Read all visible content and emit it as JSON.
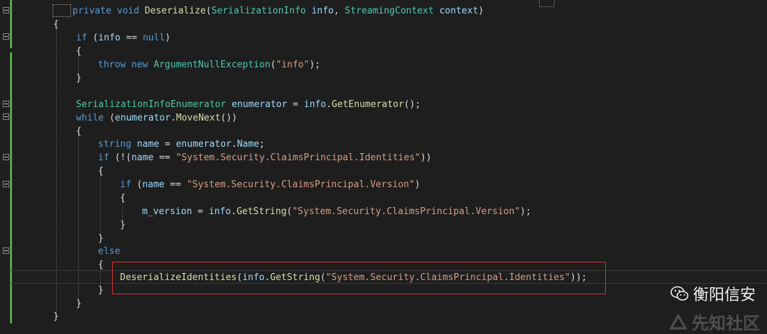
{
  "editor": {
    "lines": [
      {
        "tokens": [
          [
            "kw",
            "private "
          ],
          [
            "kw",
            "void "
          ],
          [
            "fn",
            "Deserialize"
          ],
          [
            "pl",
            "("
          ],
          [
            "ty",
            "SerializationInfo "
          ],
          [
            "id",
            "info"
          ],
          [
            "pl",
            ", "
          ],
          [
            "ty",
            "StreamingContext "
          ],
          [
            "id",
            "context"
          ],
          [
            "pl",
            ")"
          ]
        ]
      },
      {
        "tokens": [
          [
            "pl",
            "{"
          ]
        ]
      },
      {
        "tokens": [
          [
            "kw",
            "if "
          ],
          [
            "pl",
            "("
          ],
          [
            "id",
            "info "
          ],
          [
            "pl",
            "== "
          ],
          [
            "kw",
            "null"
          ],
          [
            "pl",
            ")"
          ]
        ]
      },
      {
        "tokens": [
          [
            "pl",
            "{"
          ]
        ]
      },
      {
        "tokens": [
          [
            "kw",
            "throw "
          ],
          [
            "kw",
            "new "
          ],
          [
            "ty",
            "ArgumentNullException"
          ],
          [
            "pl",
            "("
          ],
          [
            "st",
            "\"info\""
          ],
          [
            "pl",
            ");"
          ]
        ]
      },
      {
        "tokens": [
          [
            "pl",
            "}"
          ]
        ]
      },
      {
        "tokens": [
          [
            "ty",
            "SerializationInfoEnumerator "
          ],
          [
            "id",
            "enumerator "
          ],
          [
            "pl",
            "= "
          ],
          [
            "id",
            "info"
          ],
          [
            "pl",
            "."
          ],
          [
            "fn",
            "GetEnumerator"
          ],
          [
            "pl",
            "();"
          ]
        ]
      },
      {
        "tokens": [
          [
            "kw",
            "while "
          ],
          [
            "pl",
            "("
          ],
          [
            "id",
            "enumerator"
          ],
          [
            "pl",
            "."
          ],
          [
            "fn",
            "MoveNext"
          ],
          [
            "pl",
            "())"
          ]
        ]
      },
      {
        "tokens": [
          [
            "pl",
            "{"
          ]
        ]
      },
      {
        "tokens": [
          [
            "kw",
            "string "
          ],
          [
            "id",
            "name "
          ],
          [
            "pl",
            "= "
          ],
          [
            "id",
            "enumerator"
          ],
          [
            "pl",
            "."
          ],
          [
            "id",
            "Name"
          ],
          [
            "pl",
            ";"
          ]
        ]
      },
      {
        "tokens": [
          [
            "kw",
            "if "
          ],
          [
            "pl",
            "(!("
          ],
          [
            "id",
            "name "
          ],
          [
            "pl",
            "== "
          ],
          [
            "st",
            "\"System.Security.ClaimsPrincipal.Identities\""
          ],
          [
            "pl",
            "))"
          ]
        ]
      },
      {
        "tokens": [
          [
            "pl",
            "{"
          ]
        ]
      },
      {
        "tokens": [
          [
            "kw",
            "if "
          ],
          [
            "pl",
            "("
          ],
          [
            "id",
            "name "
          ],
          [
            "pl",
            "== "
          ],
          [
            "st",
            "\"System.Security.ClaimsPrincipal.Version\""
          ],
          [
            "pl",
            ")"
          ]
        ]
      },
      {
        "tokens": [
          [
            "pl",
            "{"
          ]
        ]
      },
      {
        "tokens": [
          [
            "id",
            "m_version "
          ],
          [
            "pl",
            "= "
          ],
          [
            "id",
            "info"
          ],
          [
            "pl",
            "."
          ],
          [
            "fn",
            "GetString"
          ],
          [
            "pl",
            "("
          ],
          [
            "st",
            "\"System.Security.ClaimsPrincipal.Version\""
          ],
          [
            "pl",
            ");"
          ]
        ]
      },
      {
        "tokens": [
          [
            "pl",
            "}"
          ]
        ]
      },
      {
        "tokens": [
          [
            "pl",
            "}"
          ]
        ]
      },
      {
        "tokens": [
          [
            "kw",
            "else"
          ]
        ]
      },
      {
        "tokens": [
          [
            "pl",
            "{"
          ]
        ]
      },
      {
        "tokens": [
          [
            "fn",
            "DeserializeIdentities"
          ],
          [
            "pl",
            "("
          ],
          [
            "id",
            "info"
          ],
          [
            "pl",
            "."
          ],
          [
            "fn",
            "GetString"
          ],
          [
            "pl",
            "("
          ],
          [
            "st",
            "\"System.Security.ClaimsPrincipal.Identities\""
          ],
          [
            "pl",
            "));"
          ]
        ]
      },
      {
        "tokens": [
          [
            "pl",
            "}"
          ]
        ]
      },
      {
        "tokens": [
          [
            "pl",
            "}"
          ]
        ]
      },
      {
        "tokens": [
          [
            "pl",
            "}"
          ]
        ]
      }
    ]
  },
  "colors": {
    "keyword": "#569cd6",
    "type": "#4ec9b0",
    "method": "#dcdcaa",
    "string": "#d69d85",
    "identifier": "#9cdcfe",
    "highlight": "#d9302d"
  },
  "watermark": {
    "account": "衡阳信安",
    "site": "先知社区"
  }
}
